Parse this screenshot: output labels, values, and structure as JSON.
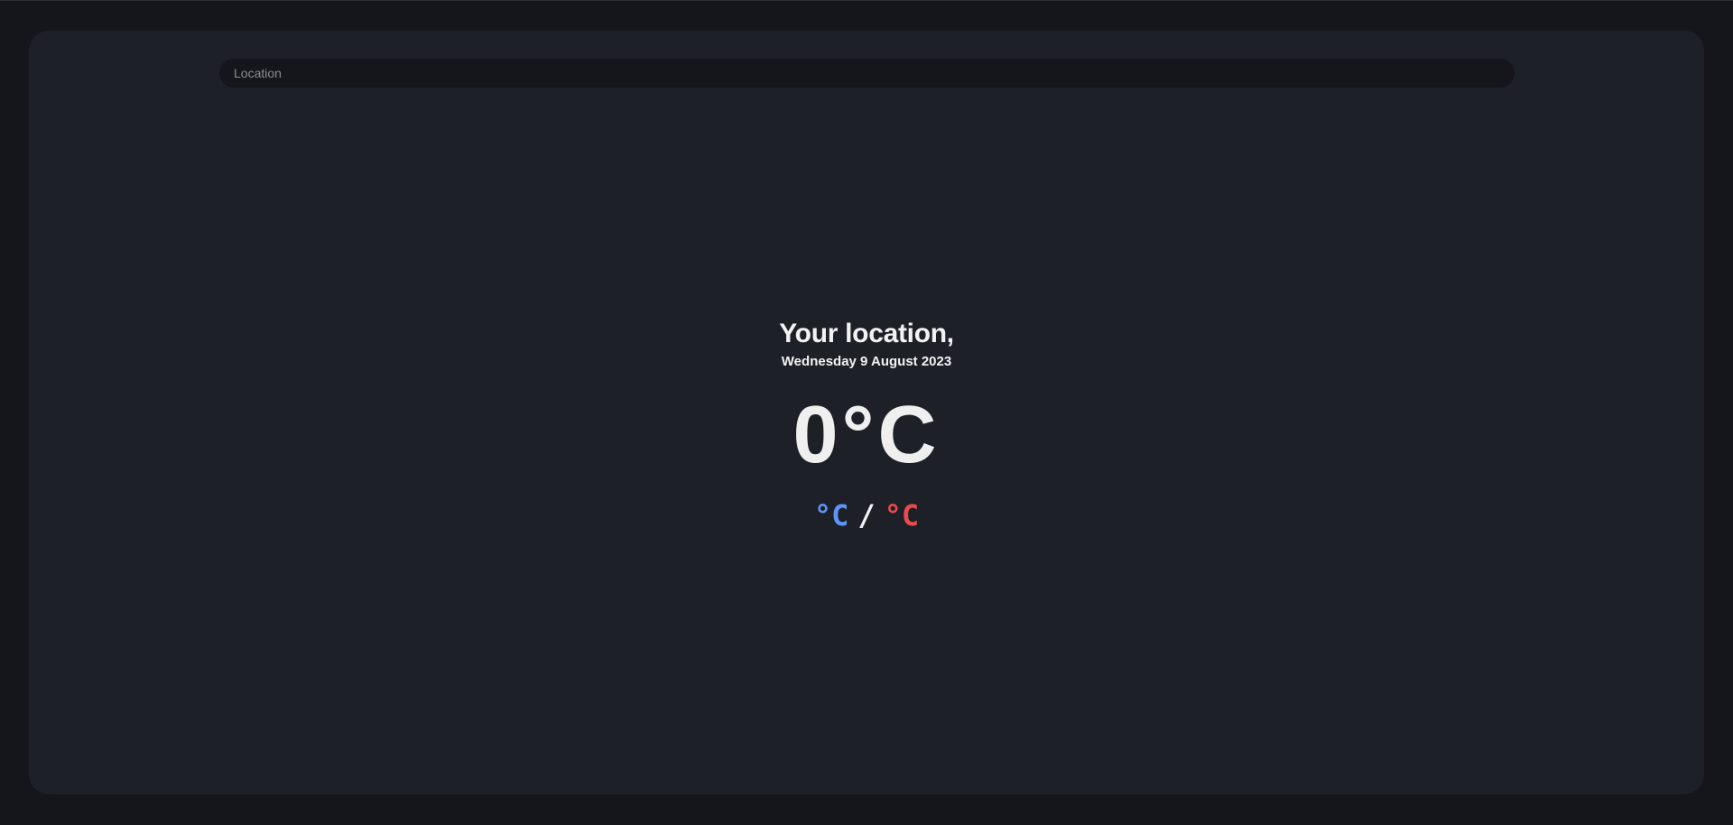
{
  "search": {
    "placeholder": "Location",
    "value": ""
  },
  "weather": {
    "location_title": "Your location,",
    "date": "Wednesday 9 August 2023",
    "temperature": "0°C",
    "min_temp": "°C",
    "separator": "/",
    "max_temp": "°C"
  },
  "colors": {
    "background": "#14161b",
    "card": "#1e2028",
    "min_temp": "#5e95f5",
    "max_temp": "#ec4a4f",
    "text": "#f2f2f2"
  }
}
